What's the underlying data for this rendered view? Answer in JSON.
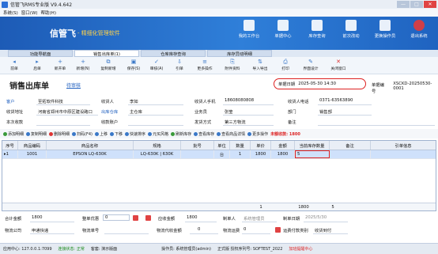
{
  "window": {
    "title": "信管飞RMS专业版 V9.4.642",
    "min_label": "—",
    "max_label": "□",
    "close_label": "✕"
  },
  "menu": {
    "items": [
      "系统(S)",
      "窗口(W)",
      "帮助(H)"
    ]
  },
  "banner": {
    "brand": "信管飞",
    "tagline": "- 精细化管理软件",
    "buttons": [
      {
        "label": "我的工作台",
        "icon": "monitor-icon"
      },
      {
        "label": "单据中心",
        "icon": "documents-icon"
      },
      {
        "label": "库存查询",
        "icon": "warehouse-icon"
      },
      {
        "label": "前次改动",
        "icon": "history-icon"
      },
      {
        "label": "更换操作员",
        "icon": "user-switch-icon"
      },
      {
        "label": "退出系统",
        "icon": "exit-icon"
      }
    ]
  },
  "tabs": [
    "功能导航面",
    "销售出库单(1)",
    "仓库库存查询",
    "库存异动明细"
  ],
  "toolbar": [
    {
      "label": "前单",
      "icon": "◂"
    },
    {
      "label": "后单",
      "icon": "▸"
    },
    {
      "label": "新开单",
      "icon": "+"
    },
    {
      "label": "新增(N)",
      "icon": "+"
    },
    {
      "label": "复制新增",
      "icon": "⧉"
    },
    {
      "label": "保存(S)",
      "icon": "▣"
    },
    {
      "label": "审核(A)",
      "icon": "✓"
    },
    {
      "label": "引单",
      "icon": "⇩"
    },
    {
      "label": "更多操作",
      "icon": "≡"
    },
    {
      "label": "附件资料",
      "icon": "⎘"
    },
    {
      "label": "导入导出",
      "icon": "⇅"
    },
    {
      "label": "打印",
      "icon": "⎙"
    },
    {
      "label": "界面设计",
      "icon": "✎"
    },
    {
      "label": "关闭窗口",
      "icon": "✕"
    }
  ],
  "header": {
    "doc_title": "销售出库单",
    "status": "待审核",
    "date_label": "单据日期",
    "date_value": "2025-05-30 14:30",
    "docno_label": "单据编号",
    "docno_value": "XSCKD-20250530-0001"
  },
  "fields": {
    "customer_label": "客户",
    "customer_value": "至拓软件科技",
    "receiver_label": "收货人",
    "receiver_value": "李如",
    "receiver_phone_label": "收货人手机",
    "receiver_phone_value": "18608080808",
    "receiver_tel_label": "收货人电话",
    "receiver_tel_value": "0371-63563890",
    "address_label": "收货地址",
    "address_value": "河南省郑州市中原区建设路口",
    "warehouse_label": "出库仓库",
    "warehouse_value": "主仓库",
    "salesman_label": "业务员",
    "salesman_value": "张莹",
    "dept_label": "部门",
    "dept_value": "销售部",
    "receivable_label": "本次收款",
    "account_label": "收款账户",
    "ship_label": "发货方式",
    "ship_value": "第三方物流",
    "remark_label": "备注"
  },
  "actions": [
    {
      "label": "添加明细",
      "color": "green"
    },
    {
      "label": "复制明细",
      "color": "blue"
    },
    {
      "label": "删除明细",
      "color": "red"
    },
    {
      "label": "扫码(F4)",
      "color": "blue"
    },
    {
      "label": "上移",
      "color": "blue"
    },
    {
      "label": "下移",
      "color": "blue"
    },
    {
      "label": "快速排序",
      "color": "blue"
    },
    {
      "label": "元买风格",
      "color": "blue"
    },
    {
      "label": "刷新库存",
      "color": "green"
    },
    {
      "label": "查看库存",
      "color": "blue"
    },
    {
      "label": "查看商品详情",
      "color": "blue"
    },
    {
      "label": "更多操作",
      "color": "blue"
    },
    {
      "label": "未额收款: 1800",
      "color": "red"
    }
  ],
  "grid": {
    "columns": [
      "序号",
      "商品编码",
      "商品名称",
      "规格",
      "批号",
      "单位",
      "数量",
      "单价",
      "金额",
      "当前库存数量",
      "备注",
      "引单信息"
    ],
    "rows": [
      {
        "seq": "1",
        "code": "1001",
        "name": "EPSON LQ-630K",
        "spec": "LQ-630K | 630K",
        "batch": "",
        "unit": "台",
        "qty": "1",
        "price": "1800",
        "amount": "1800",
        "stock": "5",
        "remark": "",
        "ref": ""
      }
    ],
    "footer_qty": "1",
    "footer_amount": "1800",
    "footer_stock": "5"
  },
  "totals": {
    "total_label": "合计金额",
    "total_value": "1800",
    "discount_label": "整单优惠",
    "discount_value": "0",
    "receivable_label": "应收金额",
    "receivable_value": "1800",
    "creator_label": "制单人",
    "creator_value": "系统管理员",
    "create_date_label": "制单日期",
    "create_date_value": "2025/5/30",
    "logistics_label": "物流公司",
    "logistics_value": "申通快递",
    "tracking_label": "物流单号",
    "tracking_value": "",
    "cod_label": "物流代收金额",
    "cod_value": "0",
    "freight_label": "物流运费",
    "freight_value": "0",
    "freight_pay_label": "运费付款类别",
    "freight_pay_value": "收货到付"
  },
  "statusbar": {
    "app": "应用中心: 127.0.0.1:7099",
    "conn": "连接状态: 正常",
    "note": "客套: 演示版面",
    "operator": "操作员: 系统管理员(admin)",
    "license": "正式版 授权序列号: SOFTEST_2022",
    "help": "加班提醒中心"
  },
  "colors": {
    "accent": "#2f7fd9",
    "highlight": "#d22222",
    "selected": "#cfe1fb"
  }
}
